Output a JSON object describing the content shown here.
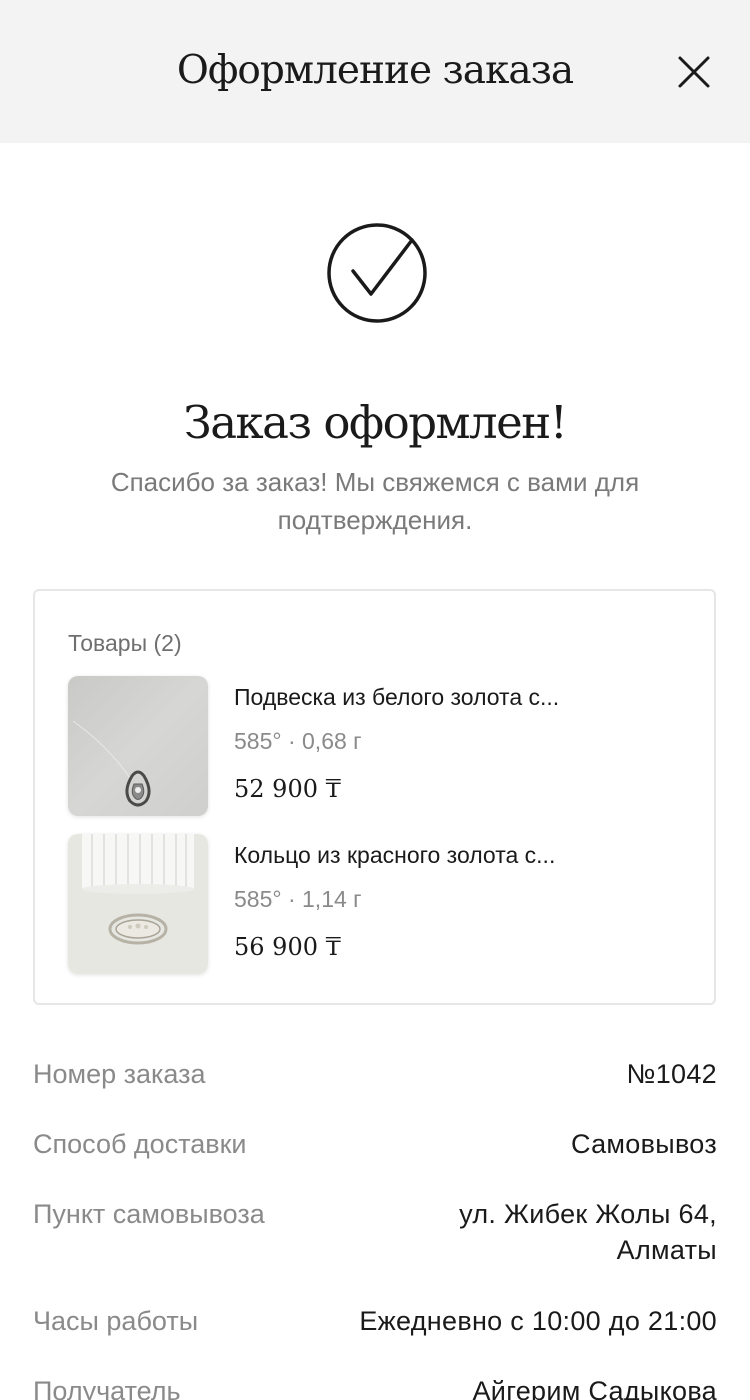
{
  "header": {
    "title": "Оформление заказа",
    "close_icon": "close-icon"
  },
  "success": {
    "icon": "check-circle-icon",
    "title": "Заказ оформлен!",
    "subtitle": "Спасибо за заказ! Мы свяжемся с вами для подтверждения."
  },
  "items": {
    "label": "Товары (2)",
    "list": [
      {
        "name": "Подвеска из белого золота с...",
        "meta": "585° · 0,68 г",
        "price": "52 900 ₸",
        "image": "pendant-photo"
      },
      {
        "name": "Кольцо из красного золота с...",
        "meta": "585° · 1,14 г",
        "price": "56 900 ₸",
        "image": "ring-photo"
      }
    ]
  },
  "details": [
    {
      "label": "Номер заказа",
      "value": "№1042"
    },
    {
      "label": "Способ доставки",
      "value": "Самовывоз"
    },
    {
      "label": "Пункт самовывоза",
      "value": "ул. Жибек Жолы 64, Алматы"
    },
    {
      "label": "Часы работы",
      "value": "Ежедневно с 10:00 до 21:00"
    },
    {
      "label": "Получатель",
      "value": "Айгерим Садыкова"
    }
  ],
  "colors": {
    "header_bg": "#f3f3f3",
    "text": "#1a1a1a",
    "muted": "#8a8a8a",
    "border": "#e6e6e6"
  }
}
